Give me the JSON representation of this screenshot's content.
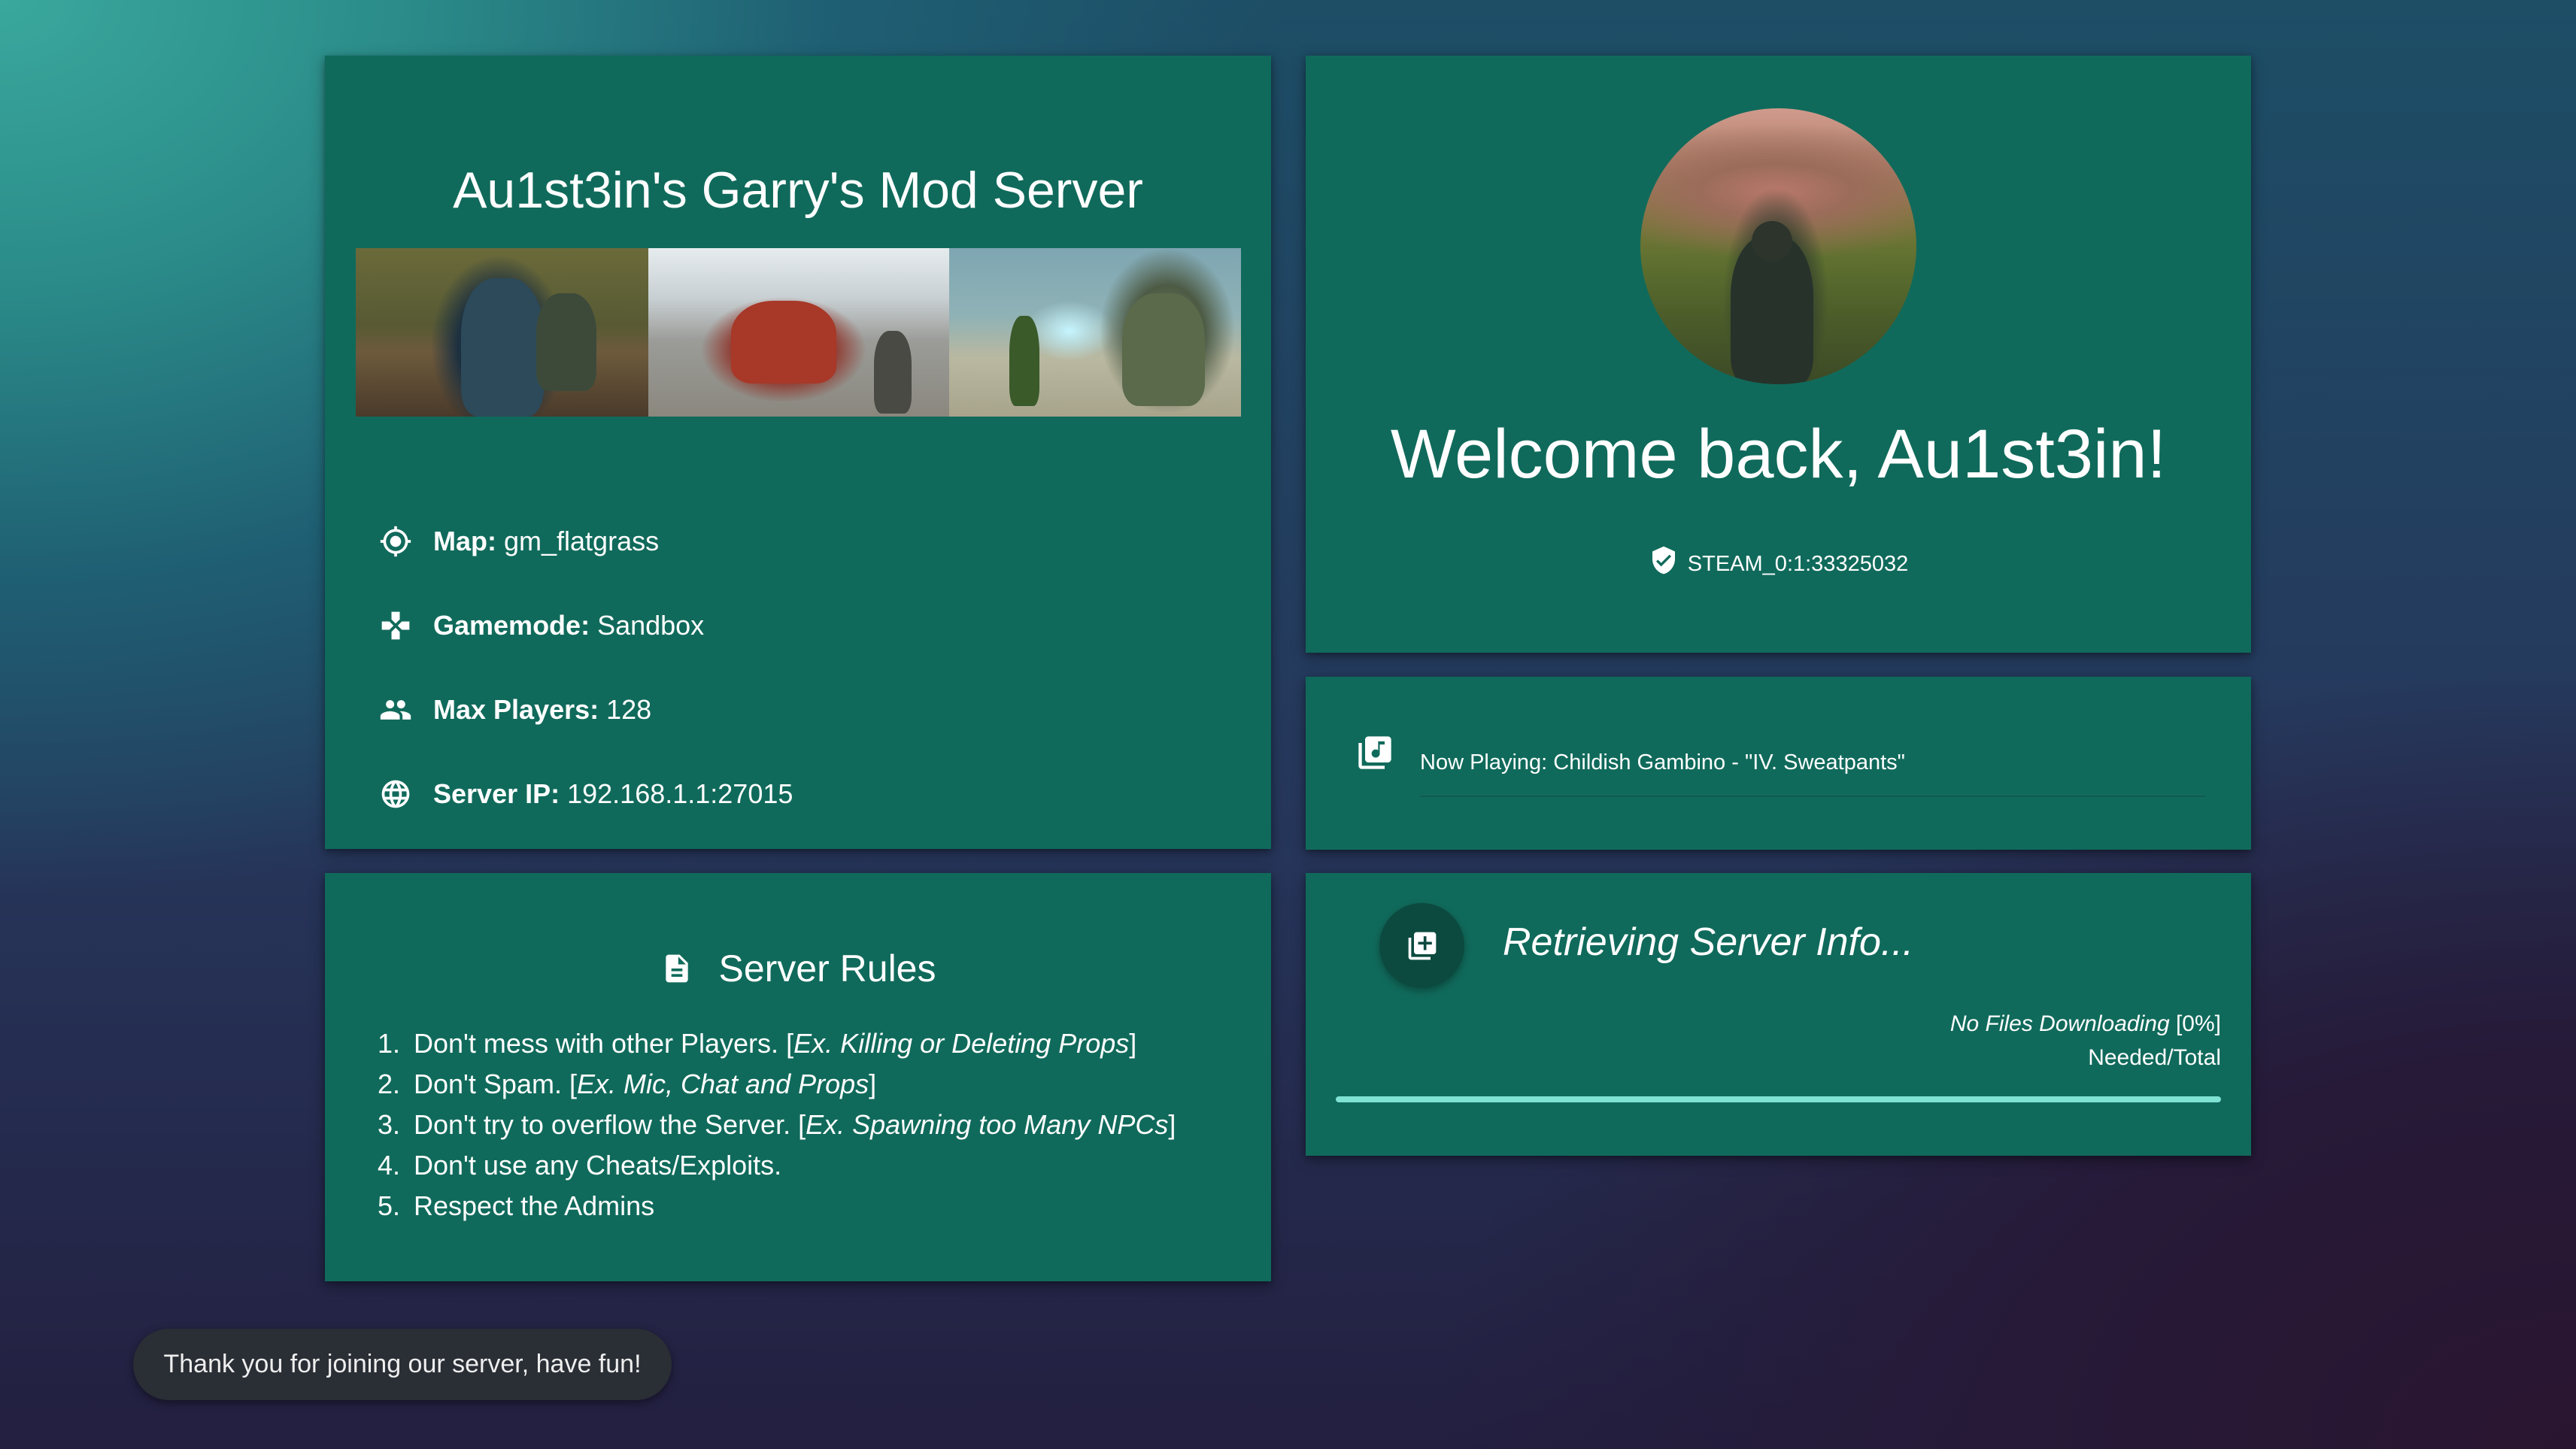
{
  "server": {
    "title": "Au1st3in's Garry's Mod Server",
    "gallery": [
      "screenshot-1",
      "screenshot-2",
      "screenshot-3"
    ],
    "info": [
      {
        "icon": "crosshair-icon",
        "label": "Map:",
        "value": "gm_flatgrass"
      },
      {
        "icon": "gamepad-icon",
        "label": "Gamemode:",
        "value": "Sandbox"
      },
      {
        "icon": "players-icon",
        "label": "Max Players:",
        "value": "128"
      },
      {
        "icon": "globe-icon",
        "label": "Server IP:",
        "value": "192.168.1.1:27015"
      }
    ]
  },
  "rules": {
    "heading": "Server Rules",
    "icon": "document-icon",
    "items": [
      {
        "num": "1.",
        "text": "Don't mess with other Players. ",
        "example": "Ex. Killing or Deleting Props"
      },
      {
        "num": "2.",
        "text": "Don't Spam. ",
        "example": "Ex. Mic, Chat and Props"
      },
      {
        "num": "3.",
        "text": "Don't try to overflow the Server. ",
        "example": "Ex. Spawning too Many NPCs"
      },
      {
        "num": "4.",
        "text": "Don't use any Cheats/Exploits.",
        "example": ""
      },
      {
        "num": "5.",
        "text": "Respect the Admins",
        "example": ""
      }
    ]
  },
  "welcome": {
    "message": "Welcome back, Au1st3in!",
    "steam_id": "STEAM_0:1:33325032",
    "shield_icon": "verified-shield-icon"
  },
  "music": {
    "icon": "music-library-icon",
    "now_playing": "Now Playing: Childish Gambino - \"IV. Sweatpants\""
  },
  "loading": {
    "icon": "add-library-icon",
    "status": "Retrieving Server Info...",
    "download_label": "No Files Downloading",
    "download_percent": "[0%]",
    "needed_total": "Needed/Total",
    "progress": 1.0,
    "progress_color": "#7fe3d4"
  },
  "toast": {
    "message": "Thank you for joining our server, have fun!"
  },
  "colors": {
    "card": "#106a5b",
    "fab": "#0c4a3f",
    "toast": "#2a2e35"
  }
}
